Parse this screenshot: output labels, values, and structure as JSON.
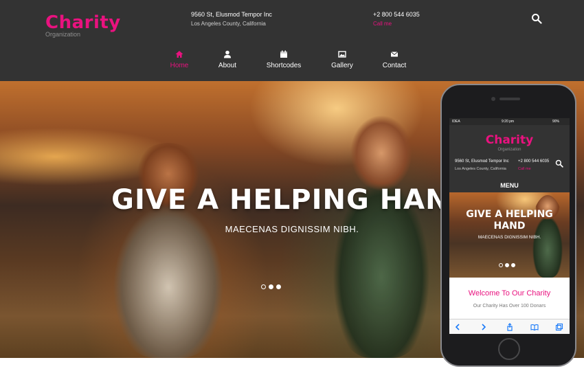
{
  "brand": {
    "name": "Charity",
    "tagline": "Organization",
    "accent_color": "#e9127f",
    "header_bg": "#333333"
  },
  "contact": {
    "address_line1": "9560 St, Elusmod Tempor Inc",
    "address_line2": "Los Angeles County, California",
    "phone": "+2 800 544 6035",
    "call_label": "Call me"
  },
  "search": {
    "icon": "search-icon"
  },
  "nav": {
    "items": [
      {
        "label": "Home",
        "icon": "home-icon",
        "active": true
      },
      {
        "label": "About",
        "icon": "user-icon",
        "active": false
      },
      {
        "label": "Shortcodes",
        "icon": "calendar-icon",
        "active": false
      },
      {
        "label": "Gallery",
        "icon": "image-icon",
        "active": false
      },
      {
        "label": "Contact",
        "icon": "envelope-icon",
        "active": false
      }
    ]
  },
  "hero": {
    "title": "GIVE A HELPING HAND",
    "subtitle": "MAECENAS DIGNISSIM NIBH.",
    "slide_count": 3,
    "active_slide": 1
  },
  "mobile": {
    "status_carrier": "IDEA",
    "status_time": "9:20 pm",
    "status_battery": "90%",
    "brand": "Charity",
    "tagline": "Organization",
    "address_line1": "9560 St, Elusmod Tempor Inc",
    "address_line2": "Los Angeles County, California",
    "phone": "+2 800 544 6035",
    "call_label": "Call me",
    "menu_label": "MENU",
    "hero_title_line1": "GIVE A HELPING",
    "hero_title_line2": "HAND",
    "hero_subtitle": "MAECENAS DIGNISSIM NIBH.",
    "welcome": "Welcome To Our Charity",
    "donors": "Our Charity Has Over 100 Donars"
  }
}
